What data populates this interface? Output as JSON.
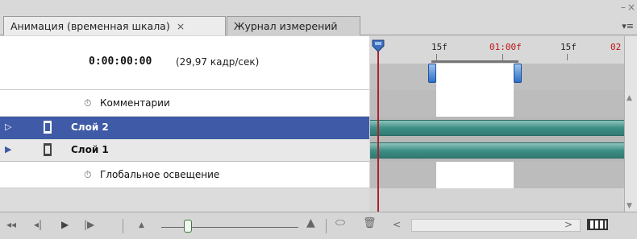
{
  "tabs": [
    {
      "label": "Анимация (временная шкала)",
      "close": "×",
      "active": true
    },
    {
      "label": "Журнал измерений",
      "active": false
    }
  ],
  "window_controls": {
    "minimize": "–",
    "close": "×",
    "menu": "▾≡"
  },
  "timecode": {
    "value": "0:00:00:00",
    "fps": "(29,97 кадр/сек)"
  },
  "rows": {
    "comments": "Комментарии",
    "layer2": "Слой 2",
    "layer1": "Слой 1",
    "global_light": "Глобальное освещение"
  },
  "ruler": {
    "labels": [
      "15f",
      "01:00f",
      "15f",
      "02"
    ],
    "red_labels": [
      "01:00f",
      "02"
    ]
  },
  "colors": {
    "selected_row": "#3f5aa6",
    "track": "#3f8f86",
    "playhead": "#b0202e",
    "work_area": "#2e6ec6"
  },
  "toolbar": {
    "first_frame": "◂◂",
    "prev_frame": "◂|",
    "play": "▶",
    "next_frame": "|▶",
    "zoom_out": "▲",
    "zoom_in": "▲",
    "convert_icon": "convert-to-frame-animation-icon",
    "delete_icon": "trash-icon",
    "scroll_left": "<",
    "scroll_right": ">"
  }
}
